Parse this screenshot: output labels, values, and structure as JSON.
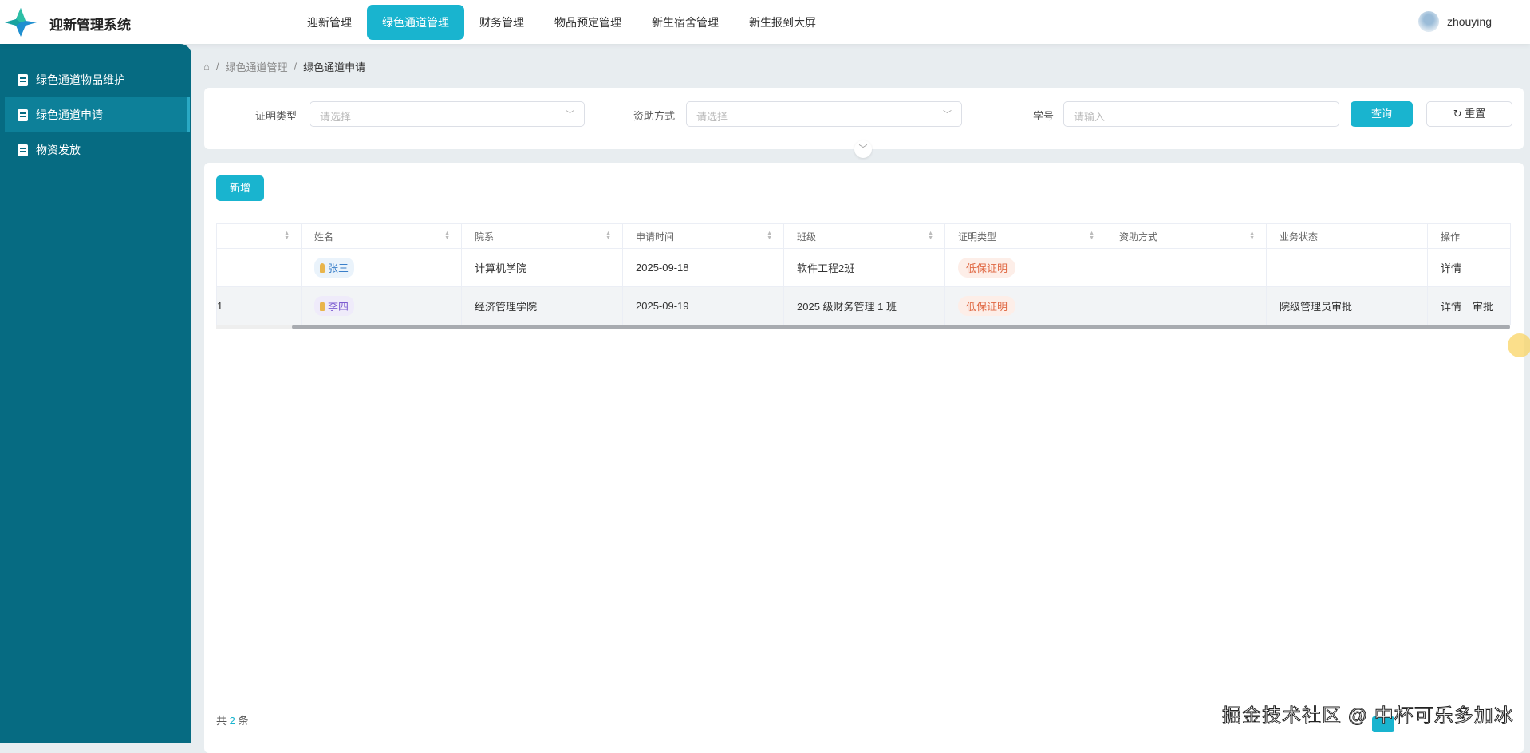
{
  "app": {
    "title": "迎新管理系统"
  },
  "nav": [
    {
      "label": "迎新管理"
    },
    {
      "label": "绿色通道管理",
      "active": true
    },
    {
      "label": "财务管理"
    },
    {
      "label": "物品预定管理"
    },
    {
      "label": "新生宿舍管理"
    },
    {
      "label": "新生报到大屏"
    }
  ],
  "user": {
    "name": "zhouying"
  },
  "sidebar": [
    {
      "label": "绿色通道物品维护"
    },
    {
      "label": "绿色通道申请",
      "active": true
    },
    {
      "label": "物资发放"
    }
  ],
  "breadcrumb": {
    "sep": "/",
    "items": [
      "绿色通道管理",
      "绿色通道申请"
    ]
  },
  "filters": {
    "cert_type": {
      "label": "证明类型",
      "placeholder": "请选择"
    },
    "aid_method": {
      "label": "资助方式",
      "placeholder": "请选择"
    },
    "student_no": {
      "label": "学号",
      "placeholder": "请输入"
    },
    "query": "查询",
    "reset": "重置"
  },
  "toolbar": {
    "add": "新增"
  },
  "table": {
    "columns": [
      "",
      "姓名",
      "院系",
      "申请时间",
      "班级",
      "证明类型",
      "资助方式",
      "业务状态",
      "操作"
    ],
    "rows": [
      {
        "id": "",
        "name": "张三",
        "dept": "计算机学院",
        "date": "2025-09-18",
        "class": "软件工程2班",
        "cert": "低保证明",
        "aid": "",
        "status": "",
        "ops": [
          "详情"
        ]
      },
      {
        "id": "1",
        "name": "李四",
        "dept": "经济管理学院",
        "date": "2025-09-19",
        "class": "2025 级财务管理 1 班",
        "cert": "低保证明",
        "aid": "",
        "status": "院级管理员审批",
        "ops": [
          "详情",
          "审批"
        ]
      }
    ]
  },
  "pagination": {
    "prefix": "共",
    "total": "2",
    "suffix": "条"
  },
  "watermark": "掘金技术社区 @ 中杯可乐多加冰",
  "colors": {
    "primary": "#19b4cf",
    "sidebar": "#066b82"
  }
}
